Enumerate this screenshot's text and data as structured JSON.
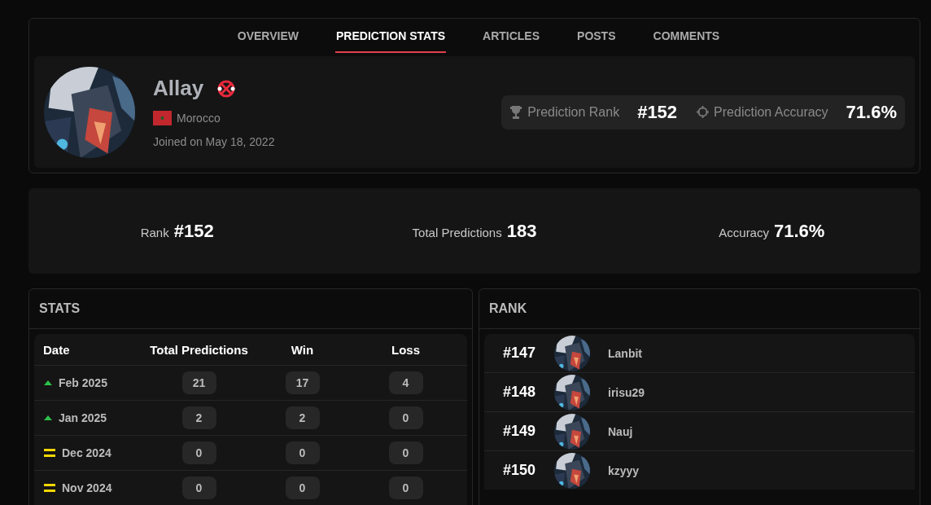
{
  "tabs": [
    {
      "label": "OVERVIEW",
      "selected": false
    },
    {
      "label": "PREDICTION STATS",
      "selected": true
    },
    {
      "label": "ARTICLES",
      "selected": false
    },
    {
      "label": "POSTS",
      "selected": false
    },
    {
      "label": "COMMENTS",
      "selected": false
    }
  ],
  "profile": {
    "name": "Allay",
    "country": "Morocco",
    "joined": "Joined on May 18, 2022",
    "rank_label": "Prediction Rank",
    "rank_value": "#152",
    "accuracy_label": "Prediction Accuracy",
    "accuracy_value": "71.6%"
  },
  "summary": [
    {
      "label": "Rank",
      "value": "#152"
    },
    {
      "label": "Total Predictions",
      "value": "183"
    },
    {
      "label": "Accuracy",
      "value": "71.6%"
    }
  ],
  "stats": {
    "title": "STATS",
    "columns": [
      "Date",
      "Total Predictions",
      "Win",
      "Loss"
    ],
    "rows": [
      {
        "kind": "up",
        "date": "Feb 2025",
        "total": "21",
        "win": "17",
        "loss": "4"
      },
      {
        "kind": "up",
        "date": "Jan 2025",
        "total": "2",
        "win": "2",
        "loss": "0"
      },
      {
        "kind": "same",
        "date": "Dec 2024",
        "total": "0",
        "win": "0",
        "loss": "0"
      },
      {
        "kind": "same",
        "date": "Nov 2024",
        "total": "0",
        "win": "0",
        "loss": "0"
      }
    ]
  },
  "rank": {
    "title": "RANK",
    "rows": [
      {
        "rank": "#147",
        "name": "Lanbit"
      },
      {
        "rank": "#148",
        "name": "irisu29"
      },
      {
        "rank": "#149",
        "name": "Nauj"
      },
      {
        "rank": "#150",
        "name": "kzyyy"
      }
    ]
  }
}
